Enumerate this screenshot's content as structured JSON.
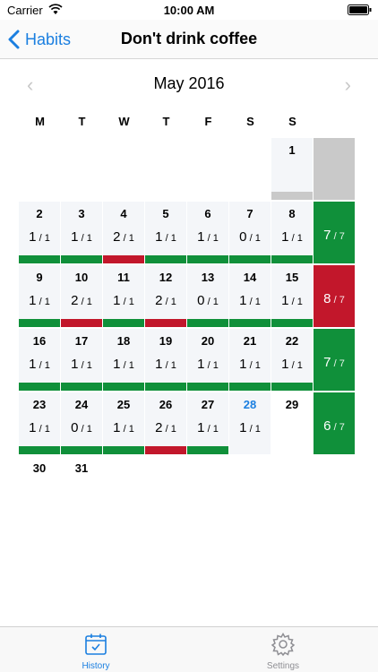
{
  "status_bar": {
    "carrier": "Carrier",
    "time": "10:00 AM"
  },
  "nav": {
    "back_label": "Habits",
    "title": "Don't drink coffee"
  },
  "month": {
    "title": "May 2016",
    "prev_icon": "chevron-left-icon",
    "next_icon": "chevron-right-icon"
  },
  "weekdays": [
    "M",
    "T",
    "W",
    "T",
    "F",
    "S",
    "S"
  ],
  "weeks": [
    {
      "days": [
        null,
        null,
        null,
        null,
        null,
        null,
        {
          "day": "1",
          "count": "",
          "status": "gray"
        }
      ],
      "total": {
        "value": "",
        "status": "gray"
      }
    },
    {
      "days": [
        {
          "day": "2",
          "count": "1",
          "status": "green"
        },
        {
          "day": "3",
          "count": "1",
          "status": "green"
        },
        {
          "day": "4",
          "count": "2",
          "status": "red"
        },
        {
          "day": "5",
          "count": "1",
          "status": "green"
        },
        {
          "day": "6",
          "count": "1",
          "status": "green"
        },
        {
          "day": "7",
          "count": "0",
          "status": "green"
        },
        {
          "day": "8",
          "count": "1",
          "status": "green"
        }
      ],
      "total": {
        "value": "7",
        "status": "green"
      }
    },
    {
      "days": [
        {
          "day": "9",
          "count": "1",
          "status": "green"
        },
        {
          "day": "10",
          "count": "2",
          "status": "red"
        },
        {
          "day": "11",
          "count": "1",
          "status": "green"
        },
        {
          "day": "12",
          "count": "2",
          "status": "red"
        },
        {
          "day": "13",
          "count": "0",
          "status": "green"
        },
        {
          "day": "14",
          "count": "1",
          "status": "green"
        },
        {
          "day": "15",
          "count": "1",
          "status": "green"
        }
      ],
      "total": {
        "value": "8",
        "status": "red"
      }
    },
    {
      "days": [
        {
          "day": "16",
          "count": "1",
          "status": "green"
        },
        {
          "day": "17",
          "count": "1",
          "status": "green"
        },
        {
          "day": "18",
          "count": "1",
          "status": "green"
        },
        {
          "day": "19",
          "count": "1",
          "status": "green"
        },
        {
          "day": "20",
          "count": "1",
          "status": "green"
        },
        {
          "day": "21",
          "count": "1",
          "status": "green"
        },
        {
          "day": "22",
          "count": "1",
          "status": "green"
        }
      ],
      "total": {
        "value": "7",
        "status": "green"
      }
    },
    {
      "days": [
        {
          "day": "23",
          "count": "1",
          "status": "green"
        },
        {
          "day": "24",
          "count": "0",
          "status": "green"
        },
        {
          "day": "25",
          "count": "1",
          "status": "green"
        },
        {
          "day": "26",
          "count": "2",
          "status": "red"
        },
        {
          "day": "27",
          "count": "1",
          "status": "green"
        },
        {
          "day": "28",
          "count": "1",
          "status": "none",
          "today": true
        },
        {
          "day": "29",
          "plain": true
        }
      ],
      "total": {
        "value": "6",
        "status": "green"
      }
    }
  ],
  "trailing_days": [
    "30",
    "31"
  ],
  "daily_limit": "1",
  "weekly_limit": "7",
  "colors": {
    "green": "#10903a",
    "red": "#c2172b",
    "gray": "#c9c9c9",
    "accent": "#1b7fe0"
  },
  "tabbar": {
    "history_label": "History",
    "history_icon": "calendar-icon",
    "settings_label": "Settings",
    "settings_icon": "gear-icon"
  }
}
